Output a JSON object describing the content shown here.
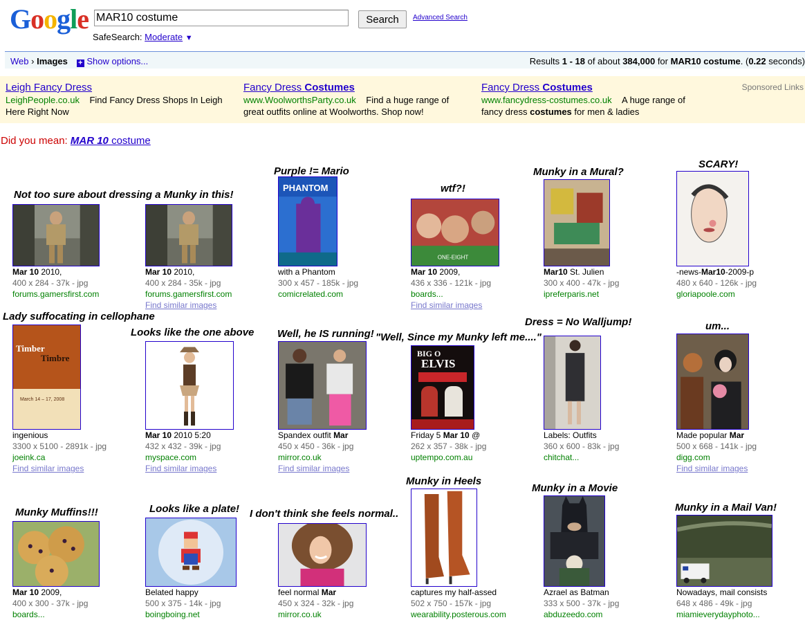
{
  "header": {
    "logo_text": "Google",
    "search_value": "MAR10 costume",
    "search_button": "Search",
    "advanced_search": "Advanced Search",
    "safesearch_label": "SafeSearch:",
    "safesearch_value": "Moderate",
    "safesearch_arrow": "▼"
  },
  "bar": {
    "web": "Web",
    "sep": "›",
    "images": "Images",
    "plus": "+",
    "show_options": "Show options...",
    "results_text": "Results 1 - 18 of about 384,000 for MAR10 costume. (0.22 seconds)"
  },
  "ads": {
    "sponsored": "Sponsored Links",
    "items": [
      {
        "title": "Leigh Fancy Dress",
        "url": "LeighPeople.co.uk",
        "desc_a": "Find Fancy Dress Shops In Leigh",
        "desc_b": "Here Right Now"
      },
      {
        "title": "Fancy Dress Costumes",
        "url": "www.WoolworthsParty.co.uk",
        "desc_a": "Find a huge range of",
        "desc_b": "great outfits online at Woolworths. Shop now!"
      },
      {
        "title": "Fancy Dress Costumes",
        "url": "www.fancydress-costumes.co.uk",
        "desc_a": "A huge range of",
        "desc_b": "fancy dress costumes for men & ladies"
      }
    ]
  },
  "did_you_mean": {
    "label": "Did you mean:",
    "query": "MAR 10 costume"
  },
  "results": [
    {
      "caption": "Not too sure about dressing a Munky in this!",
      "desc": "Mar 10 2010,",
      "size": "400 x 284 - 37k - jpg",
      "host": "forums.gamersfirst.com",
      "similar": "",
      "icon": "game-character-image"
    },
    {
      "caption": "",
      "desc": "Mar 10 2010,",
      "size": "400 x 284 - 35k - jpg",
      "host": "forums.gamersfirst.com",
      "similar": "Find similar images",
      "icon": "game-character-image"
    },
    {
      "caption": "Purple != Mario",
      "desc": "with a Phantom",
      "size": "300 x 457 - 185k - jpg",
      "host": "comicrelated.com",
      "similar": "",
      "icon": "comic-cover-image"
    },
    {
      "caption": "wtf?!",
      "desc": "Mar 10 2009,",
      "size": "436 x 336 - 121k - jpg",
      "host": "boards...",
      "similar": "Find similar images",
      "icon": "collage-image"
    },
    {
      "caption": "Munky in a Mural?",
      "desc": "Mar10 St. Julien",
      "size": "300 x 400 - 47k - jpg",
      "host": "ipreferparis.net",
      "similar": "",
      "icon": "mural-image"
    },
    {
      "caption": "SCARY!",
      "desc": "-news-Mar10-2009-p",
      "size": "480 x 640 - 126k - jpg",
      "host": "gloriapoole.com",
      "similar": "",
      "icon": "sketch-image"
    },
    {
      "caption": "Lady suffocating in cellophane",
      "desc": "ingenious",
      "size": "3300 x 5100 - 2891k - jpg",
      "host": "joeink.ca",
      "similar": "Find similar images",
      "icon": "poster-image",
      "poster_a": "Timber",
      "poster_b": "Timbre",
      "poster_c": "March 14 – 17, 2008"
    },
    {
      "caption": "Looks like the one above",
      "desc": "Mar 10 2010 5:20",
      "size": "432 x 432 - 39k - jpg",
      "host": "myspace.com",
      "similar": "Find similar images",
      "icon": "costume-image"
    },
    {
      "caption": "Well, he IS running!",
      "desc": "Spandex outfit Mar",
      "size": "450 x 450 - 36k - jpg",
      "host": "mirror.co.uk",
      "similar": "Find similar images",
      "icon": "street-photo-image"
    },
    {
      "caption": "\"Well, Since my Munky left me....\"",
      "desc": "Friday 5 Mar 10 @",
      "size": "262 x 357 - 38k - jpg",
      "host": "uptempo.com.au",
      "similar": "",
      "icon": "elvis-poster-image",
      "poster_a": "BIG O",
      "poster_b": "ELVIS"
    },
    {
      "caption": "Dress = No Walljump!",
      "desc": "Labels: Outfits",
      "size": "360 x 600 - 83k - jpg",
      "host": "chitchat...",
      "similar": "",
      "icon": "dress-photo-image"
    },
    {
      "caption": "um...",
      "desc": "Made popular Mar",
      "size": "500 x 668 - 141k - jpg",
      "host": "digg.com",
      "similar": "Find similar images",
      "icon": "party-photo-image"
    },
    {
      "caption": "Munky Muffins!!!",
      "desc": "Mar 10 2009,",
      "size": "400 x 300 - 37k - jpg",
      "host": "boards...",
      "similar": "",
      "icon": "muffins-image"
    },
    {
      "caption": "Looks like a plate!",
      "desc": "Belated happy",
      "size": "500 x 375 - 14k - jpg",
      "host": "boingboing.net",
      "similar": "",
      "icon": "mario-plate-image"
    },
    {
      "caption": "I don't think she feels normal..",
      "desc": "feel normal Mar",
      "size": "450 x 324 - 32k - jpg",
      "host": "mirror.co.uk",
      "similar": "",
      "icon": "portrait-image"
    },
    {
      "caption": "Munky in Heels",
      "desc": "captures my half-assed",
      "size": "502 x 750 - 157k - jpg",
      "host": "wearability.posterous.com",
      "similar": "",
      "icon": "boots-image"
    },
    {
      "caption": "Munky in a Movie",
      "desc": "Azrael as Batman",
      "size": "333 x 500 - 37k - jpg",
      "host": "abduzeedo.com",
      "similar": "",
      "icon": "batman-image"
    },
    {
      "caption": "Munky in a Mail Van!",
      "desc": "Nowadays, mail consists",
      "size": "648 x 486 - 49k - jpg",
      "host": "miamieverydayphoto...",
      "similar": "",
      "icon": "mail-van-image"
    }
  ]
}
